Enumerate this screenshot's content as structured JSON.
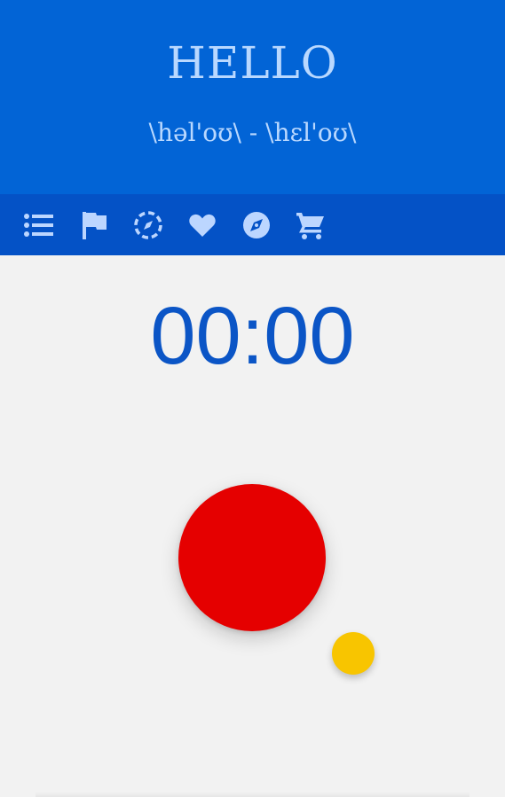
{
  "header": {
    "word": "HELLO",
    "phonetic": "\\həl'oʊ\\ - \\hɛl'oʊ\\"
  },
  "toolbar": {
    "icons": [
      {
        "name": "list-icon"
      },
      {
        "name": "flag-icon"
      },
      {
        "name": "compass-dashed-icon"
      },
      {
        "name": "heart-icon"
      },
      {
        "name": "compass-icon"
      },
      {
        "name": "cart-icon"
      }
    ],
    "icon_color": "#bcd6ff"
  },
  "timer": {
    "value": "00:00"
  },
  "colors": {
    "header_bg": "#0264d6",
    "toolbar_bg": "#0452c6",
    "timer_text": "#0b55c6",
    "record_button": "#e50000",
    "secondary_button": "#f8c500",
    "page_bg": "#f2f2f2"
  }
}
